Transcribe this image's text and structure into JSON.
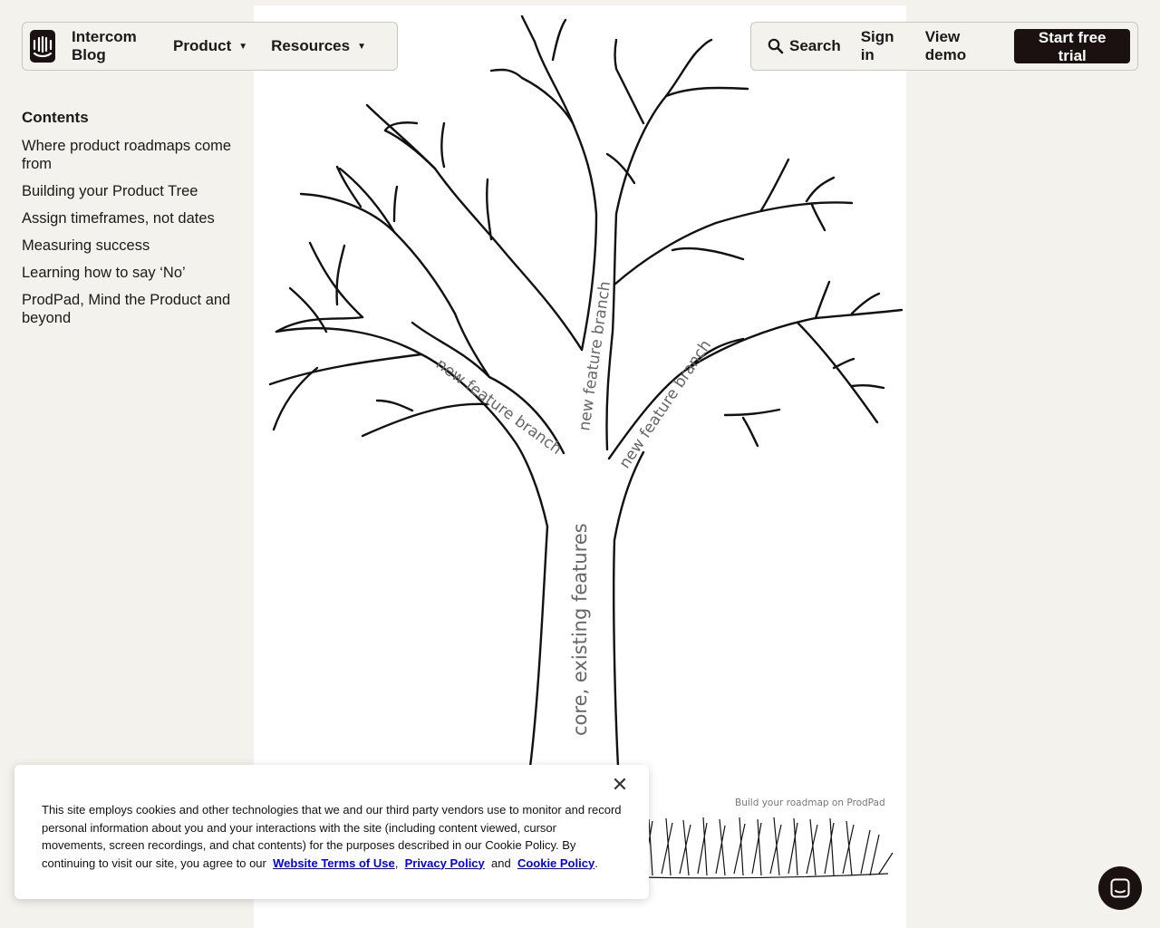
{
  "header": {
    "blog_label": "Intercom Blog",
    "product_label": "Product",
    "resources_label": "Resources",
    "search_label": "Search",
    "signin_label": "Sign in",
    "demo_label": "View demo",
    "trial_label": "Start free trial"
  },
  "toc": {
    "title": "Contents",
    "items": [
      "Where product roadmaps come from",
      "Building your Product Tree",
      "Assign timeframes, not dates",
      "Measuring success",
      "Learning how to say ‘No’",
      "ProdPad, Mind the Product and beyond"
    ]
  },
  "image": {
    "branch_left": "new feature branch",
    "branch_middle": "new feature branch",
    "branch_right": "new feature branch",
    "trunk": "core, existing features",
    "credit": "Build your roadmap on ProdPad"
  },
  "cookie": {
    "text": "This site employs cookies and other technologies that we and our third party vendors use to monitor and record personal information about you and your interactions with the site (including content viewed, cursor movements, screen recordings, and chat contents) for the purposes described in our Cookie Policy. By continuing to visit our site, you agree to our",
    "terms_link": "Website Terms of Use",
    "privacy_link": "Privacy Policy",
    "and_text": "and",
    "cookie_link": "Cookie Policy",
    "sep_comma": ",",
    "end_period": "."
  },
  "colors": {
    "page_bg": "#f3f2ec",
    "brand_dark": "#1a1110",
    "link_blue": "#0000ee"
  }
}
